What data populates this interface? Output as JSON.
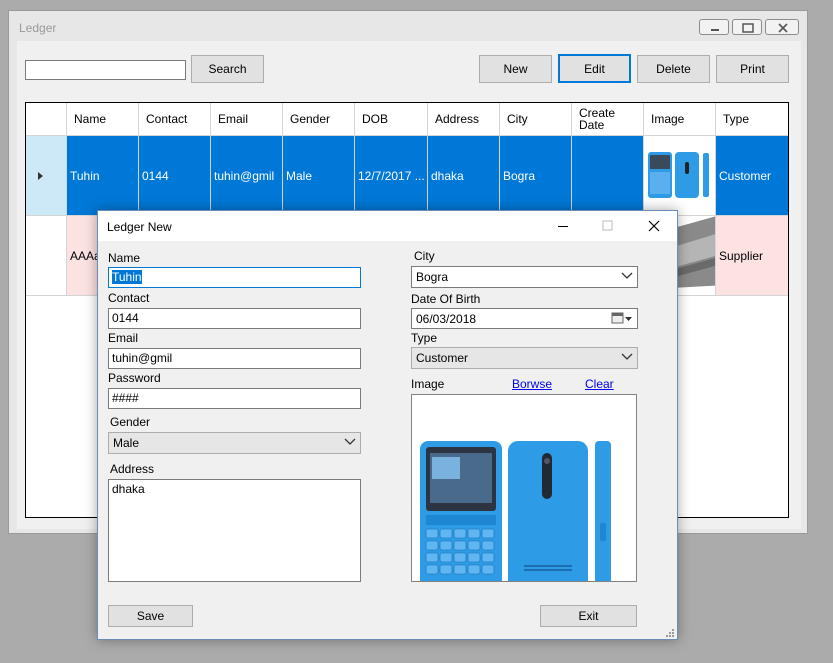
{
  "ledger": {
    "title": "Ledger",
    "search": {
      "value": "",
      "label": "Search"
    },
    "toolbar": {
      "new": "New",
      "edit": "Edit",
      "delete": "Delete",
      "print": "Print"
    },
    "columns": [
      "Name",
      "Contact",
      "Email",
      "Gender",
      "DOB",
      "Address",
      "City",
      "Create Date",
      "Image",
      "Type"
    ],
    "rows": [
      {
        "name": "Tuhin",
        "contact": "0144",
        "email": "tuhin@gmil",
        "gender": "Male",
        "dob": "12/7/2017 ...",
        "address": "dhaka",
        "city": "Bogra",
        "create_date": "",
        "image": "phone",
        "type": "Customer"
      },
      {
        "name": "AAAa",
        "type": "Supplier",
        "image": "laptop"
      }
    ]
  },
  "dialog": {
    "title": "Ledger New",
    "name": {
      "label": "Name",
      "value": "Tuhin"
    },
    "contact": {
      "label": "Contact",
      "value": "0144"
    },
    "email": {
      "label": "Email",
      "value": "tuhin@gmil"
    },
    "password": {
      "label": "Password",
      "value": "####"
    },
    "gender": {
      "label": "Gender",
      "value": "Male"
    },
    "address": {
      "label": "Address",
      "value": "dhaka"
    },
    "city": {
      "label": "City",
      "value": "Bogra"
    },
    "dob": {
      "label": "Date Of Birth",
      "value": "06/03/2018"
    },
    "type": {
      "label": "Type",
      "value": "Customer"
    },
    "image": {
      "label": "Image",
      "browse": "Borwse",
      "clear": "Clear"
    },
    "save": "Save",
    "exit": "Exit"
  },
  "colors": {
    "selection": "#0078d7",
    "focus_border": "#0078d7",
    "supplier_row": "#fde2e2",
    "phone_blue": "#2d9be6"
  }
}
